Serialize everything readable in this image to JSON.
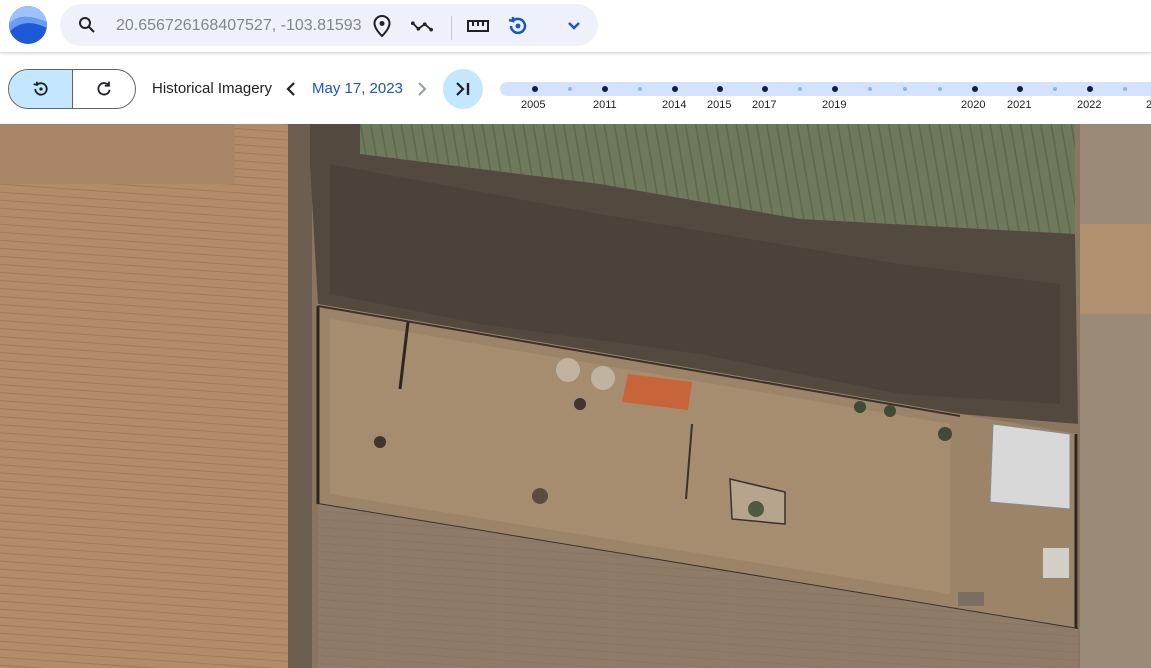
{
  "search": {
    "value": "20.656726168407527, -103.81593"
  },
  "tools": [
    "search-icon",
    "place-pin-icon",
    "path-icon",
    "ruler-icon",
    "historical-imagery-icon",
    "chevron-down-icon"
  ],
  "timeline": {
    "label": "Historical Imagery",
    "date": "May 17, 2023",
    "years": [
      "2005",
      "2011",
      "2014",
      "2015",
      "2017",
      "2019",
      "2020",
      "2021",
      "2022",
      "2"
    ]
  },
  "colors": {
    "accent": "#1a56c9",
    "chip": "#c2e7ff",
    "track": "#d3e3fd"
  }
}
